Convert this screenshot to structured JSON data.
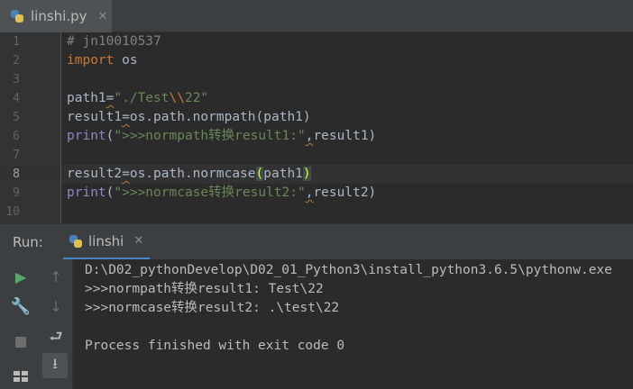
{
  "editor_tab": {
    "title": "linshi.py",
    "close_glyph": "✕",
    "icon": "python-file-icon"
  },
  "line_numbers": [
    "1",
    "2",
    "3",
    "4",
    "5",
    "6",
    "7",
    "8",
    "9",
    "10"
  ],
  "code": {
    "l1_comment": "# jn10010537",
    "l2_kw": "import",
    "l2_rest": " os",
    "l4_name": "path1",
    "l4_eq": "=",
    "l4_s1": "\"./Test",
    "l4_esc": "\\\\",
    "l4_s2": "22\"",
    "l5_name": "result1",
    "l5_eq": "=",
    "l5_rest": "os.path.normpath(path1)",
    "l6_fn": "print",
    "l6_open": "(",
    "l6_str": "\">>>normpath转换result1:\"",
    "l6_comma": ",",
    "l6_rest": "result1)",
    "l8_name": "result2",
    "l8_eq": "=",
    "l8_call": "os.path.normcase",
    "l8_lp": "(",
    "l8_arg": "path1",
    "l8_rp": ")",
    "l9_fn": "print",
    "l9_open": "(",
    "l9_str": "\">>>normcase转换result2:\"",
    "l9_comma": ",",
    "l9_rest": "result2)"
  },
  "run_panel": {
    "label": "Run:",
    "tab_title": "linshi",
    "close_glyph": "✕",
    "console": [
      "D:\\D02_pythonDevelop\\D02_01_Python3\\install_python3.6.5\\pythonw.exe",
      ">>>normpath转换result1: Test\\22",
      ">>>normcase转换result2: .\\test\\22",
      "",
      "Process finished with exit code 0"
    ]
  },
  "toolbar": {
    "rerun": "▶",
    "wrench": "🔧",
    "up": "↑",
    "down": "↓",
    "softwrap": "⮐",
    "scrollend": "⭳",
    "trash": "🗑"
  },
  "colors": {
    "background": "#2b2b2b",
    "keyword": "#cc7832",
    "string": "#6a8759",
    "builtin": "#8888c6",
    "comment": "#808080",
    "run_green": "#59a869"
  }
}
